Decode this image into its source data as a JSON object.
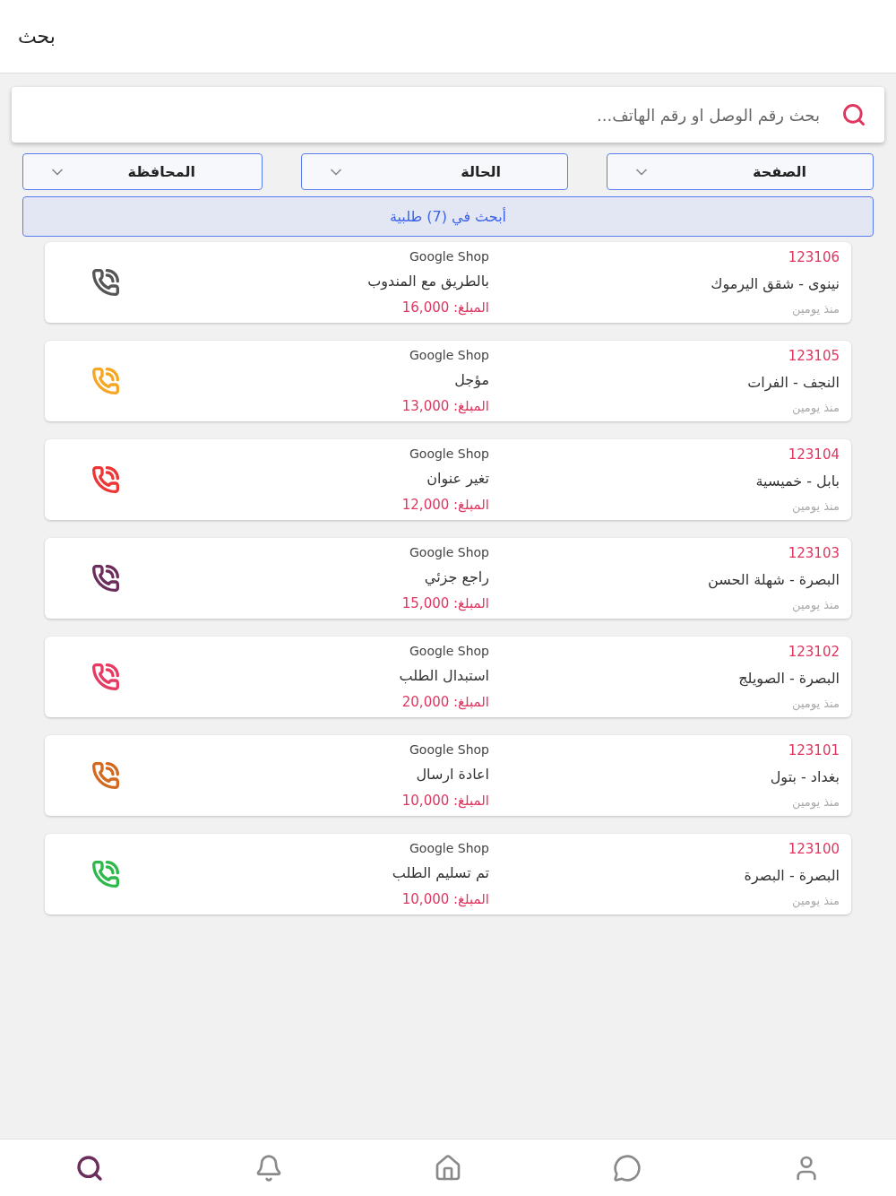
{
  "header": {
    "title": "بحث"
  },
  "search": {
    "placeholder": "بحث رقم الوصل او رقم الهاتف..."
  },
  "filters": [
    {
      "label": "الصفحة"
    },
    {
      "label": "الحالة"
    },
    {
      "label": "المحافظة"
    }
  ],
  "search_button": "أبحث في (7) طلبية",
  "orders": [
    {
      "number": "123106",
      "location": "نينوى - شقق اليرموك",
      "time": "منذ يومين",
      "shop": "Google Shop",
      "status": "بالطريق مع المندوب",
      "amount": "المبلغ: 16,000",
      "color": "#555555"
    },
    {
      "number": "123105",
      "location": "النجف - الفرات",
      "time": "منذ يومين",
      "shop": "Google Shop",
      "status": "مؤجل",
      "amount": "المبلغ: 13,000",
      "color": "#f5a623"
    },
    {
      "number": "123104",
      "location": "بابل - خميسية",
      "time": "منذ يومين",
      "shop": "Google Shop",
      "status": "تغير عنوان",
      "amount": "المبلغ: 12,000",
      "color": "#ee3535"
    },
    {
      "number": "123103",
      "location": "البصرة - شهلة الحسن",
      "time": "منذ يومين",
      "shop": "Google Shop",
      "status": "راجع جزئي",
      "amount": "المبلغ: 15,000",
      "color": "#6b2d5c"
    },
    {
      "number": "123102",
      "location": "البصرة - الصويلج",
      "time": "منذ يومين",
      "shop": "Google Shop",
      "status": "استبدال الطلب",
      "amount": "المبلغ: 20,000",
      "color": "#e63a62"
    },
    {
      "number": "123101",
      "location": "بغداد - بتول",
      "time": "منذ يومين",
      "shop": "Google Shop",
      "status": "اعادة ارسال",
      "amount": "المبلغ: 10,000",
      "color": "#d2691e"
    },
    {
      "number": "123100",
      "location": "البصرة - البصرة",
      "time": "منذ يومين",
      "shop": "Google Shop",
      "status": "تم تسليم الطلب",
      "amount": "المبلغ: 10,000",
      "color": "#2eb84b"
    }
  ],
  "nav": [
    {
      "kind": "search",
      "selected": true
    },
    {
      "kind": "notifications",
      "selected": false
    },
    {
      "kind": "home",
      "selected": false
    },
    {
      "kind": "chat",
      "selected": false
    },
    {
      "kind": "profile",
      "selected": false
    }
  ]
}
